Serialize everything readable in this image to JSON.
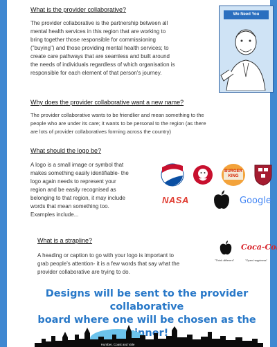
{
  "section_collaborative": {
    "heading": "What is the provider collaborative?",
    "lines": [
      "The provider collaborative is the partnership between all",
      "mental health services in this region that are working to",
      "bring together those responsible for commissioning",
      "(\"buying\") and those providing mental health services; to",
      "create care pathways that are seamless and built around",
      "the needs of individuals regardless of which organisation is",
      "responsible for each element of that person's journey."
    ]
  },
  "poster": {
    "banner": "We Need You"
  },
  "section_new_name": {
    "heading": "Why does the provider collaborative want a new name?",
    "lines": [
      "The provider collaborative wants to be friendlier and mean something to the",
      "people who are under its care; it wants to be personal to the region (as there",
      "are lots of provider collaboratives forming across the country)"
    ]
  },
  "section_logo": {
    "heading": "What should the logo be?",
    "lines": [
      "A logo is a small image or symbol that",
      "makes something easily identifiable- the",
      "logo again needs to represent your",
      "region and be easily recognised as",
      "belonging to that region, it may include",
      "words that mean something too.",
      "Examples include..."
    ]
  },
  "logos": {
    "nasa": "NASA",
    "google": "Google",
    "burger_king": [
      "BURGER",
      "KING"
    ]
  },
  "section_strapline": {
    "heading": "What is a strapline?",
    "lines": [
      "A heading or caption to go with your logo is important to",
      "grab people's attention- it is a few words that say what the",
      "provider collaborative are trying to do."
    ]
  },
  "strapline_examples": {
    "apple_caption": "\"Think different\"",
    "coca_cola": "Coca-Cola",
    "coke_caption": "\"Open happiness\""
  },
  "closing": {
    "lines": [
      "Designs will be sent to the provider collaborative",
      "board where one will be chosen as the winner!"
    ]
  },
  "footer": {
    "caption": "Humber, Coast and Vale"
  },
  "colors": {
    "accent": "#2878c8",
    "border": "#3f88d1",
    "pepsi": "#0a4fa3",
    "kfc": "#c8102e",
    "nasa": "#e03c31"
  }
}
